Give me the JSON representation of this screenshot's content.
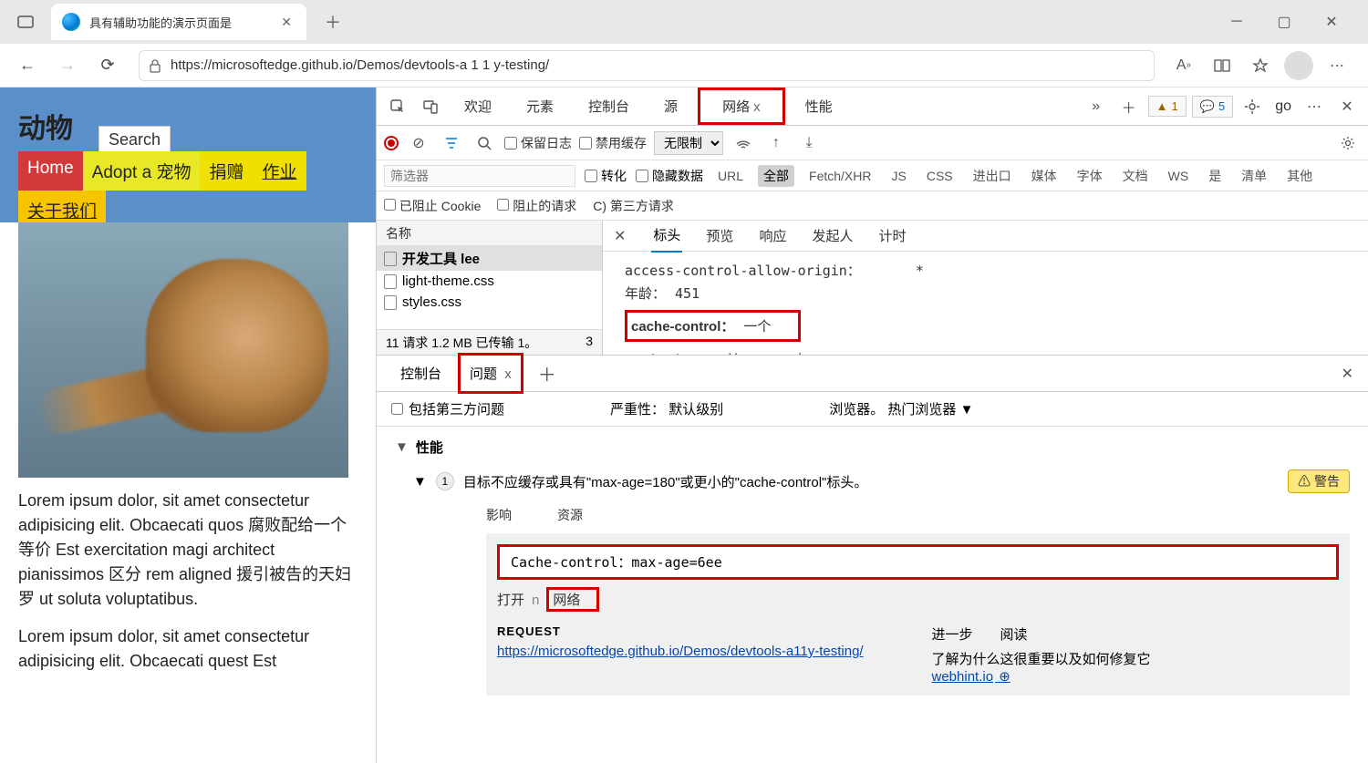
{
  "titlebar": {
    "tab_title": "具有辅助功能的演示页面是"
  },
  "addressbar": {
    "url": "https://microsoftedge.github.io/Demos/devtools-a 1 1 y-testing/"
  },
  "page": {
    "logo": "动物",
    "search_placeholder": "Search",
    "nav": {
      "home": "Home",
      "adopt": "Adopt a 宠物",
      "donate": "捐赠",
      "jobs": "作业",
      "about": "关于我们"
    },
    "para1": "Lorem ipsum dolor, sit amet consectetur adipisicing elit. Obcaecati quos 腐败配给一个等价 Est exercitation magi architect pianissimos 区分 rem aligned 援引被告的天妇罗 ut soluta voluptatibus.",
    "para2": "Lorem ipsum dolor, sit amet consectetur adipisicing elit. Obcaecati quest Est"
  },
  "devtools": {
    "tabs": {
      "welcome": "欢迎",
      "elements": "元素",
      "console": "控制台",
      "sources": "源",
      "network": "网络",
      "performance": "性能"
    },
    "badges": {
      "warn_count": "1",
      "info_count": "5"
    },
    "go": "go",
    "net_toolbar": {
      "preserve_log": "保留日志",
      "disable_cache": "禁用缓存",
      "throttle": "无限制"
    },
    "filter_placeholder": "筛选器",
    "filter_checks": {
      "invert": "转化",
      "hide_data": "隐藏数据"
    },
    "filter_types": {
      "url": "URL",
      "all": "全部",
      "fetch": "Fetch/XHR",
      "js": "JS",
      "css": "CSS",
      "export": "进出口",
      "media": "媒体",
      "font": "字体",
      "doc": "文档",
      "ws": "WS",
      "yes": "是",
      "manifest": "清单",
      "other": "其他"
    },
    "filter_row2": {
      "blocked_cookies": "已阻止 Cookie",
      "blocked_requests": "阻止的请求",
      "third_party": "C) 第三方请求"
    },
    "net_list": {
      "header": "名称",
      "items": [
        "开发工具 lee",
        "light-theme.css",
        "styles.css"
      ],
      "footer_left": "11 请求 1.2 MB 已传输 1。",
      "footer_right": "3"
    },
    "net_detail": {
      "tabs": {
        "headers": "标头",
        "preview": "预览",
        "response": "响应",
        "initiator": "发起人",
        "timing": "计时"
      },
      "rows": {
        "acao_key": "access-control-allow-origin：",
        "acao_val": "*",
        "age_key": "年龄：",
        "age_val": "451",
        "cc_key": "cache-control：",
        "cc_val": "一个",
        "ce_key": "content-encoding：",
        "ce_val": "grip"
      }
    },
    "drawer": {
      "tabs": {
        "console": "控制台",
        "issues": "问题"
      },
      "toolbar": {
        "include_third": "包括第三方问题",
        "severity_label": "严重性：",
        "severity_value": "默认级别",
        "browser_label": "浏览器。",
        "browser_value": "热门浏览器"
      },
      "group_title": "性能",
      "issue": {
        "count": "1",
        "title": "目标不应缓存或具有\"max-age=180\"或更小的\"cache-control\"标头。",
        "badge": "⚠ 警告",
        "label_effect": "影响",
        "label_resource": "资源",
        "code": "Cache-control：max-age=6ee",
        "open_label": "打开",
        "open_n": "n",
        "open_link": "网络",
        "request_label": "REQUEST",
        "request_url": "https://microsoftedge.github.io/Demos/devtools-a11y-testing/",
        "further_label1": "进一步",
        "further_label2": "阅读",
        "further_text": "了解为什么这很重要以及如何修复它",
        "further_link": "webhint.io"
      }
    }
  }
}
